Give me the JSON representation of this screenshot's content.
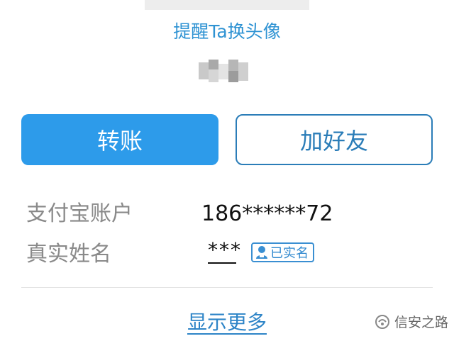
{
  "header": {
    "remind_avatar_link": "提醒Ta换头像"
  },
  "actions": {
    "transfer_label": "转账",
    "add_friend_label": "加好友"
  },
  "info": {
    "account_label": "支付宝账户",
    "account_value": "186******72",
    "name_label": "真实姓名",
    "name_value": "***",
    "verified_badge": "已实名"
  },
  "footer": {
    "show_more": "显示更多"
  },
  "watermark": {
    "text": "信安之路"
  },
  "colors": {
    "accent": "#2d9bea",
    "link": "#2f93d3"
  }
}
